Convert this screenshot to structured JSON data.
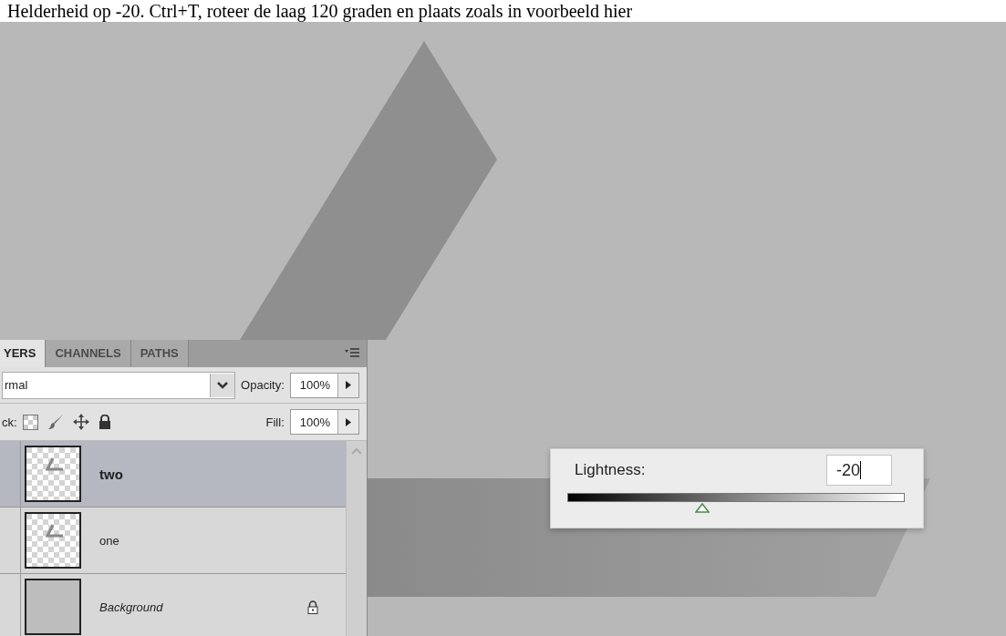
{
  "caption": "Helderheid op -20. Ctrl+T, roteer de laag 120 graden en plaats zoals in voorbeeld hier",
  "layers_panel": {
    "tabs": [
      {
        "label": "YERS",
        "selected": true
      },
      {
        "label": "CHANNELS",
        "selected": false
      },
      {
        "label": "PATHS",
        "selected": false
      }
    ],
    "blend_mode": "rmal",
    "opacity_label": "Opacity:",
    "opacity": "100%",
    "lock_label": "ck:",
    "fill_label": "Fill:",
    "fill": "100%",
    "layers": [
      {
        "name": "two",
        "kind": "shape",
        "selected": true,
        "locked": false
      },
      {
        "name": "one",
        "kind": "shape",
        "selected": false,
        "locked": false
      },
      {
        "name": "Background",
        "kind": "background",
        "selected": false,
        "locked": true
      }
    ]
  },
  "lightness": {
    "label": "Lightness:",
    "value": "-20",
    "level": 0.4
  }
}
